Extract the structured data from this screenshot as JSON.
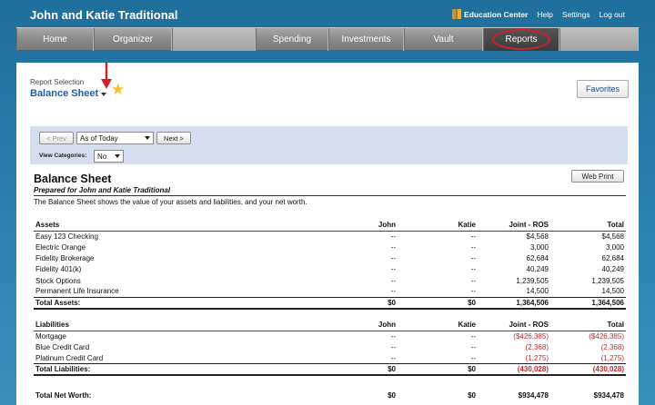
{
  "app": {
    "title": "John and Katie Traditional"
  },
  "toplinks": {
    "education": "Education Center",
    "help": "Help",
    "settings": "Settings",
    "logout": "Log out"
  },
  "nav": [
    {
      "label": "Home"
    },
    {
      "label": "Organizer"
    },
    {
      "label": ""
    },
    {
      "label": "Spending"
    },
    {
      "label": "Investments"
    },
    {
      "label": "Vault"
    },
    {
      "label": "Reports"
    },
    {
      "label": ""
    }
  ],
  "report_selection": {
    "label": "Report Selection",
    "name": "Balance Sheet",
    "favorites": "Favorites"
  },
  "toolbar": {
    "prev": "< Prev",
    "as_of": "As of Today",
    "next": "Next >",
    "view_categories_label": "View Categories:",
    "view_categories_value": "No"
  },
  "report": {
    "title": "Balance Sheet",
    "subtitle": "Prepared for John and Katie Traditional",
    "description": "The Balance Sheet shows the value of your assets and liabilities, and your net worth.",
    "web_print": "Web Print"
  },
  "columns": [
    "John",
    "Katie",
    "Joint - ROS",
    "Total"
  ],
  "assets": {
    "heading": "Assets",
    "rows": [
      {
        "name": "Easy 123 Checking",
        "john": "--",
        "katie": "--",
        "joint": "$4,568",
        "total": "$4,568"
      },
      {
        "name": "Electric Orange",
        "john": "--",
        "katie": "--",
        "joint": "3,000",
        "total": "3,000"
      },
      {
        "name": "Fidelity Brokerage",
        "john": "--",
        "katie": "--",
        "joint": "62,684",
        "total": "62,684"
      },
      {
        "name": "Fidelity 401(k)",
        "john": "--",
        "katie": "--",
        "joint": "40,249",
        "total": "40,249"
      },
      {
        "name": "Stock Options",
        "john": "--",
        "katie": "--",
        "joint": "1,239,505",
        "total": "1,239,505"
      },
      {
        "name": "Permanent Life Insurance",
        "john": "--",
        "katie": "--",
        "joint": "14,500",
        "total": "14,500"
      }
    ],
    "total": {
      "name": "Total Assets:",
      "john": "$0",
      "katie": "$0",
      "joint": "1,364,506",
      "total": "1,364,506"
    }
  },
  "liabilities": {
    "heading": "Liabilities",
    "rows": [
      {
        "name": "Mortgage",
        "john": "--",
        "katie": "--",
        "joint": "($426,385)",
        "total": "($426,385)"
      },
      {
        "name": "Blue Credit Card",
        "john": "--",
        "katie": "--",
        "joint": "(2,368)",
        "total": "(2,368)"
      },
      {
        "name": "Platinum Credit Card",
        "john": "--",
        "katie": "--",
        "joint": "(1,275)",
        "total": "(1,275)"
      }
    ],
    "total": {
      "name": "Total Liabilities:",
      "john": "$0",
      "katie": "$0",
      "joint": "(430,028)",
      "total": "(430,028)"
    }
  },
  "net_worth": {
    "name": "Total Net Worth:",
    "john": "$0",
    "katie": "$0",
    "joint": "$934,478",
    "total": "$934,478"
  },
  "colors": {
    "accent": "#1e5fa8",
    "negative": "#c62828",
    "highlight_ring": "#d0202a"
  }
}
